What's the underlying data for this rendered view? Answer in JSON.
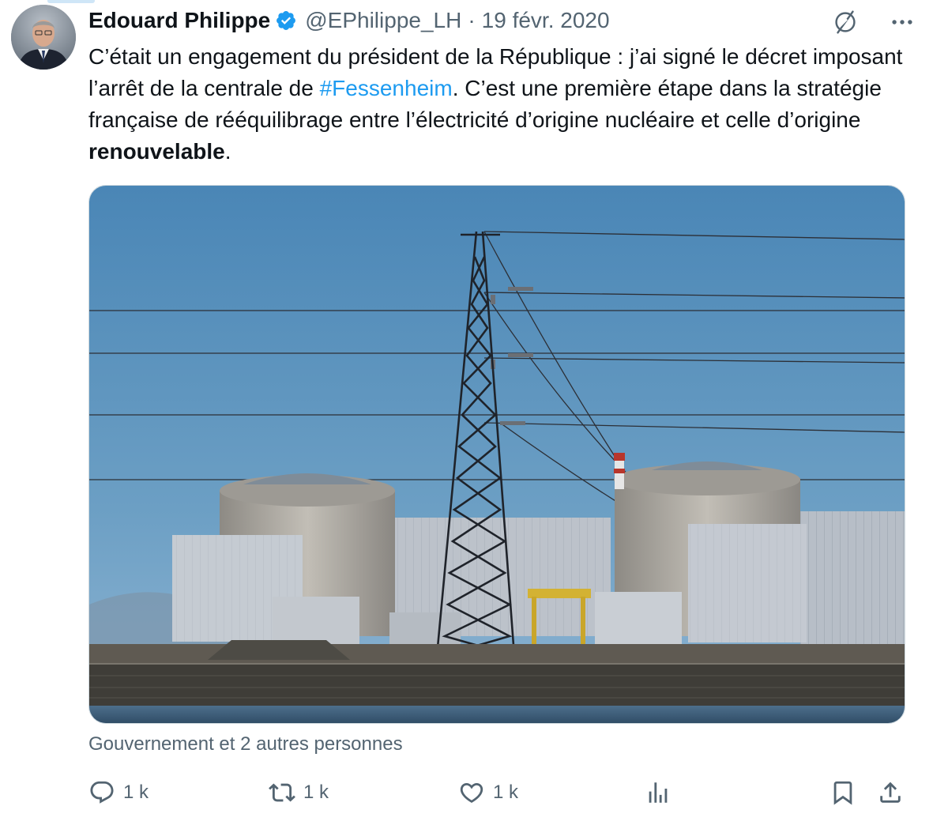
{
  "author": {
    "display_name": "Edouard Philippe",
    "handle": "@EPhilippe_LH",
    "separator": "·",
    "date": "19 févr. 2020",
    "verified_color": "#1d9bf0"
  },
  "tweet": {
    "text_part1": "C’était un engagement du président de la République : j’ai signé le décret imposant l’arrêt de la centrale de ",
    "hashtag": "#Fessenheim",
    "text_part2": ". C’est une première étape dans la stratégie française de rééquilibrage entre l’électricité d’origine nucléaire et celle d’origine ",
    "bold_word": "renouvelable",
    "text_part3": "."
  },
  "media": {
    "alt": "nuclear-power-plant-photo"
  },
  "context": {
    "text": "Gouvernement et 2 autres personnes"
  },
  "actions": {
    "reply_count": "1 k",
    "retweet_count": "1 k",
    "like_count": "1 k"
  },
  "icons": {
    "reply": "reply-icon",
    "retweet": "retweet-icon",
    "like": "heart-icon",
    "views": "analytics-icon",
    "bookmark": "bookmark-icon",
    "share": "share-icon",
    "grok": "grok-icon",
    "more": "more-icon"
  },
  "colors": {
    "text_primary": "#0f1419",
    "text_secondary": "#536471",
    "link": "#1d9bf0"
  }
}
